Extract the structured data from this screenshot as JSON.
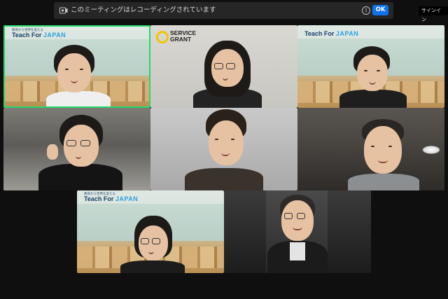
{
  "recording_banner": {
    "text": "このミーティングはレコーディングされています",
    "ok_label": "OK",
    "info_icon": "info-icon",
    "recording_icon": "recording-icon"
  },
  "signin": {
    "label": "サインイン"
  },
  "tiles": [
    {
      "logo_small": "教育から世界を変える",
      "logo_main": "Teach For",
      "logo_accent": "JAPAN",
      "active": true
    },
    {
      "logo_line1": "SERVICE",
      "logo_line2": "GRANT"
    },
    {
      "logo_small": "",
      "logo_main": "Teach For",
      "logo_accent": "JAPAN"
    },
    {},
    {},
    {},
    {
      "logo_small": "教育から世界を変える",
      "logo_main": "Teach For",
      "logo_accent": "JAPAN"
    },
    {}
  ],
  "colors": {
    "active_speaker": "#23d96b",
    "ok_button": "#0e72ed",
    "service_grant_ring": "#f5c400",
    "tfj_navy": "#193f69",
    "tfj_blue": "#2fa2dc"
  }
}
